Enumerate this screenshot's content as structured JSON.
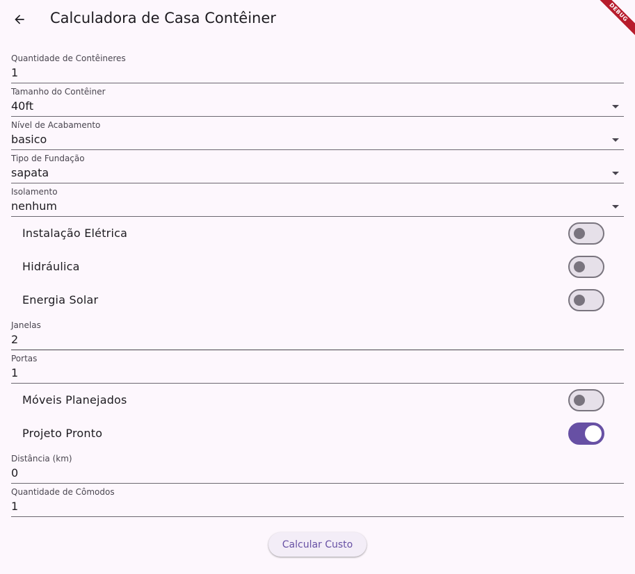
{
  "app_bar": {
    "title": "Calculadora de Casa Contêiner",
    "back_icon": "arrow-back-icon",
    "debug_banner": "DEBUG"
  },
  "form": {
    "quantidade_conteineres": {
      "label": "Quantidade de Contêineres",
      "value": "1"
    },
    "tamanho_conteiner": {
      "label": "Tamanho do Contêiner",
      "value": "40ft"
    },
    "nivel_acabamento": {
      "label": "Nível de Acabamento",
      "value": "basico"
    },
    "tipo_fundacao": {
      "label": "Tipo de Fundação",
      "value": "sapata"
    },
    "isolamento": {
      "label": "Isolamento",
      "value": "nenhum"
    },
    "instalacao_eletrica": {
      "label": "Instalação Elétrica",
      "on": false
    },
    "hidraulica": {
      "label": "Hidráulica",
      "on": false
    },
    "energia_solar": {
      "label": "Energia Solar",
      "on": false
    },
    "janelas": {
      "label": "Janelas",
      "value": "2"
    },
    "portas": {
      "label": "Portas",
      "value": "1"
    },
    "moveis_planejados": {
      "label": "Móveis Planejados",
      "on": false
    },
    "projeto_pronto": {
      "label": "Projeto Pronto",
      "on": true
    },
    "distancia": {
      "label": "Distância (km)",
      "value": "0"
    },
    "quantidade_comodos": {
      "label": "Quantidade de Cômodos",
      "value": "1"
    }
  },
  "actions": {
    "calcular_label": "Calcular Custo"
  },
  "colors": {
    "background": "#fdf7fd",
    "primary": "#6750a4",
    "switch_off_track": "#e6e0e9",
    "switch_off_border": "#79747e",
    "debug_banner": "#b71c2c"
  }
}
